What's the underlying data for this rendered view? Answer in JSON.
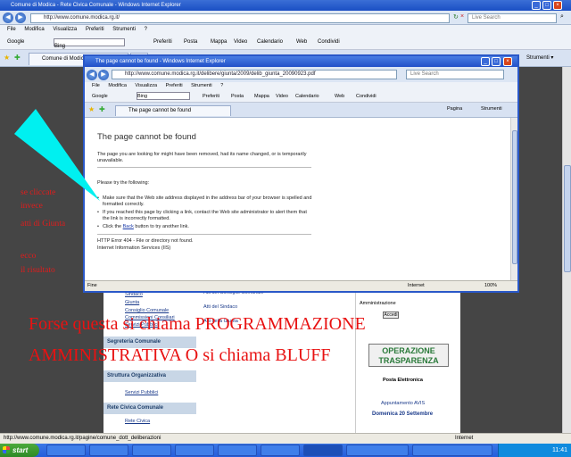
{
  "bg_window": {
    "title": "Comune di Modica - Rete Civica Comunale - Windows Internet Explorer",
    "address": "http://www.comune.modica.rg.it/",
    "search_placeholder": "Live Search",
    "menu": [
      "File",
      "Modifica",
      "Visualizza",
      "Preferiti",
      "Strumenti",
      "?"
    ],
    "links_bar": [
      "Google",
      "Bing",
      "Preferiti",
      "Posta",
      "Mappa",
      "Video",
      "Calendario",
      "Web",
      "Condividi"
    ],
    "tab_label": "Comune di Modica - Rete...",
    "tab2_label": "",
    "status_text": "http://www.comune.modica.rg.it/pagine/comune_dott_deliberazioni",
    "status_zone": "Internet"
  },
  "fg_window": {
    "title": "The page cannot be found - Windows Internet Explorer",
    "address": "http://www.comune.modica.rg.it/delibere/giunta/2009/delib_giunta_20090923.pdf",
    "search_placeholder": "Live Search",
    "menu": [
      "File",
      "Modifica",
      "Visualizza",
      "Preferiti",
      "Strumenti",
      "?"
    ],
    "links_bar": [
      "Google",
      "Bing",
      "Preferiti",
      "Posta",
      "Mappa",
      "Video",
      "Calendario",
      "Web",
      "Condividi"
    ],
    "tab_label": "The page cannot be found",
    "toolbar_right": [
      "Pagina",
      "Strumenti"
    ],
    "status_text": "Fine",
    "status_zone": "Internet",
    "zoom": "100%"
  },
  "error_page": {
    "heading": "The page cannot be found",
    "intro": "The page you are looking for might have been removed, had its name changed, or is temporarily unavailable.",
    "try_label": "Please try the following:",
    "bullet1": "Make sure that the Web site address displayed in the address bar of your browser is spelled and formatted correctly.",
    "bullet2": "If you reached this page by clicking a link, contact the Web site administrator to alert them that the link is incorrectly formatted.",
    "bullet3_pre": "Click the ",
    "bullet3_link": "Back",
    "bullet3_post": " button to try another link.",
    "error_code": "HTTP Error 404 - File or directory not found.",
    "server": "Internet Information Services (IIS)"
  },
  "site": {
    "left_groups": [
      "Segreteria Comunale",
      "Struttura Organizzativa",
      "Rete Civica Comunale"
    ],
    "left_items": [
      "Sindaco",
      "Giunta",
      "Consiglio Comunale",
      "Commissioni Consiliari",
      "Servizi Pubblici",
      "Rete Civica"
    ],
    "mid_items": [
      "Atti del Consiglio Comunale",
      "Atti del Sindaco",
      "Atti della Giunta"
    ],
    "right_admin": "Amministrazione",
    "right_btn": "Accedi",
    "op_title": "OPERAZIONE TRASPARENZA",
    "posta_label": "Posta Elettronica",
    "appuntamento": "Appuntamento AVIS",
    "data_evento": "Domenica 20 Settembre"
  },
  "taskbar": {
    "start": "start",
    "items": [
      "",
      "",
      "",
      "",
      "",
      "",
      "",
      "",
      ""
    ],
    "clock": "11:41"
  },
  "annotations": {
    "small_lines": [
      "se cliccate",
      "invece",
      "atti di Giunta",
      "ecco",
      "il risultato"
    ],
    "big_line1": "Forse questa si chiama PROGRAMMAZIONE",
    "big_line2": "AMMINISTRATIVA  O  si chiama BLUFF",
    "arrow_color": "#00f0f0",
    "text_color": "#e81212"
  }
}
